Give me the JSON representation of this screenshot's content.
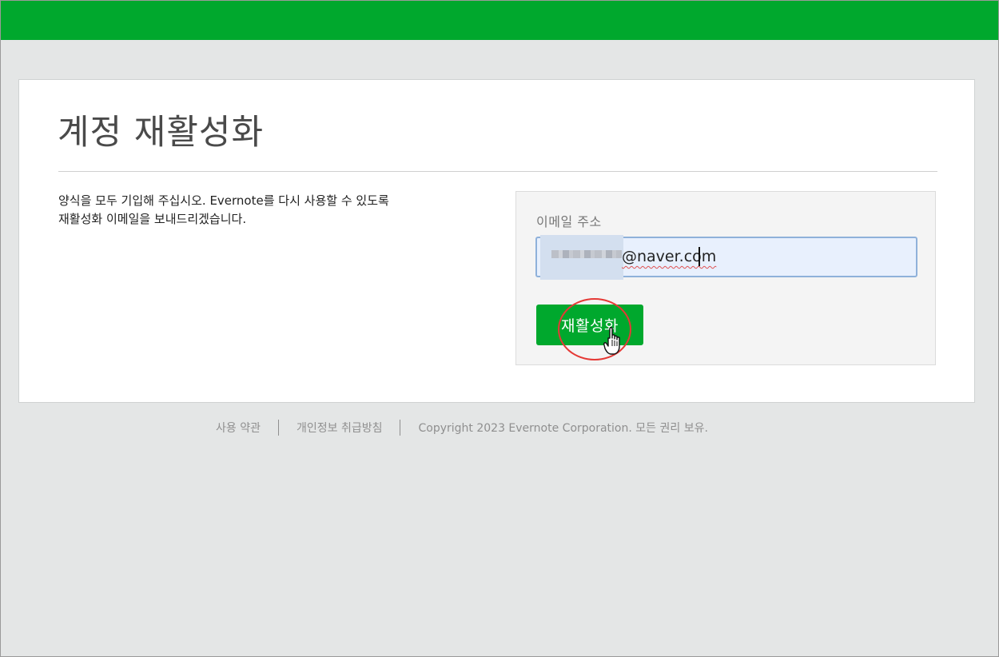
{
  "colors": {
    "brand_green": "#00a82d",
    "page_background": "#e4e6e6",
    "highlight_red": "#e53935"
  },
  "page": {
    "title": "계정 재활성화",
    "instructions_line1": "양식을 모두 기입해 주십시오. Evernote를 다시 사용할 수 있도록",
    "instructions_line2": "재활성화 이메일을 보내드리겠습니다."
  },
  "form": {
    "email_label": "이메일 주소",
    "email_value_visible": "@naver.com",
    "submit_label": "재활성화"
  },
  "footer": {
    "terms_link": "사용 약관",
    "privacy_link": "개인정보 취급방침",
    "copyright": "Copyright 2023 Evernote Corporation. 모든 권리 보유."
  },
  "icons": {
    "cursor": "hand-pointer-icon"
  }
}
